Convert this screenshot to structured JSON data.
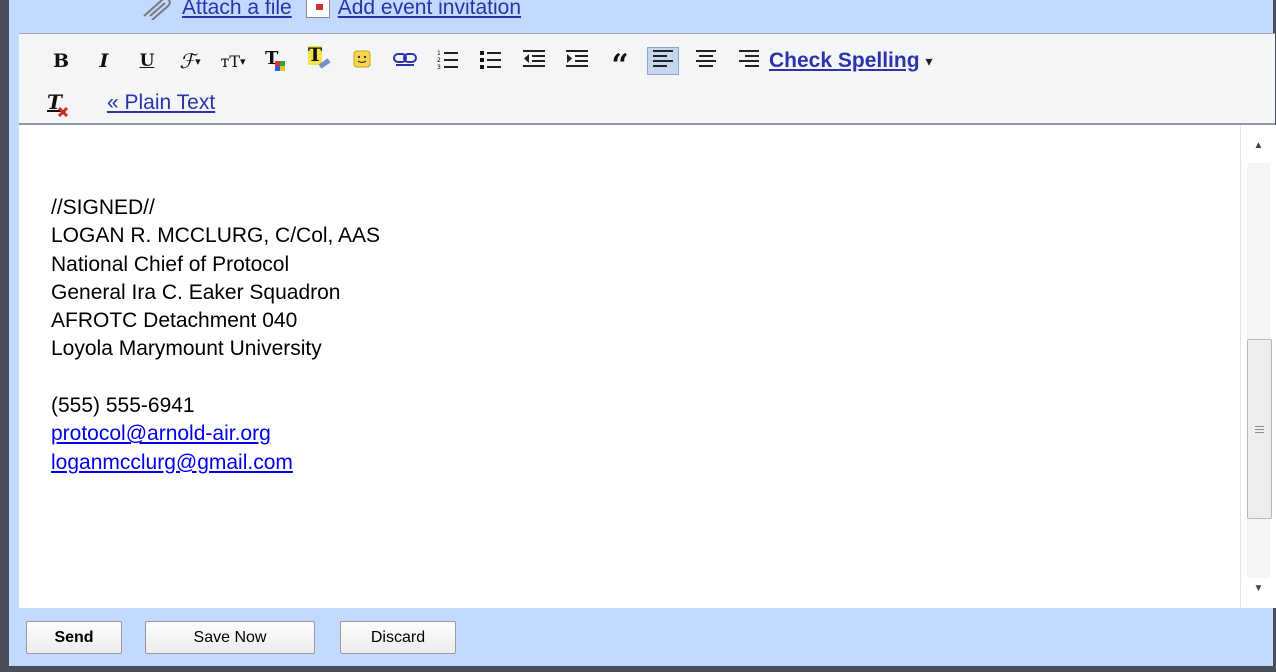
{
  "attachments": {
    "attach_label": "Attach a file",
    "event_label": "Add event invitation"
  },
  "toolbar": {
    "bold_glyph": "B",
    "italic_glyph": "I",
    "underline_glyph": "U",
    "font_glyph": "ℱ",
    "size_glyph": "тT",
    "text_color_glyph": "T",
    "highlight_glyph": "T",
    "check_spelling_label": "Check Spelling",
    "check_spelling_arrow": "▾",
    "plain_text_label": "« Plain Text",
    "active_tool": "align-left",
    "accent_color": "#2a33a9",
    "active_bg": "#c4d7ee"
  },
  "message": {
    "lines": [
      "//SIGNED//",
      "LOGAN R. MCCLURG, C/Col, AAS",
      "National Chief of Protocol",
      "General Ira C. Eaker Squadron",
      "AFROTC Detachment 040",
      "Loyola Marymount University"
    ],
    "phone": "(555) 555-6941",
    "links": [
      "protocol@arnold-air.org",
      "loganmcclurg@gmail.com"
    ]
  },
  "scroll": {
    "position_fraction": 0.43
  },
  "buttons": {
    "send": "Send",
    "save_now": "Save Now",
    "discard": "Discard"
  },
  "colors": {
    "frame": "#4b4f59",
    "background": "#c3d9ff",
    "link": "#0000ee"
  }
}
